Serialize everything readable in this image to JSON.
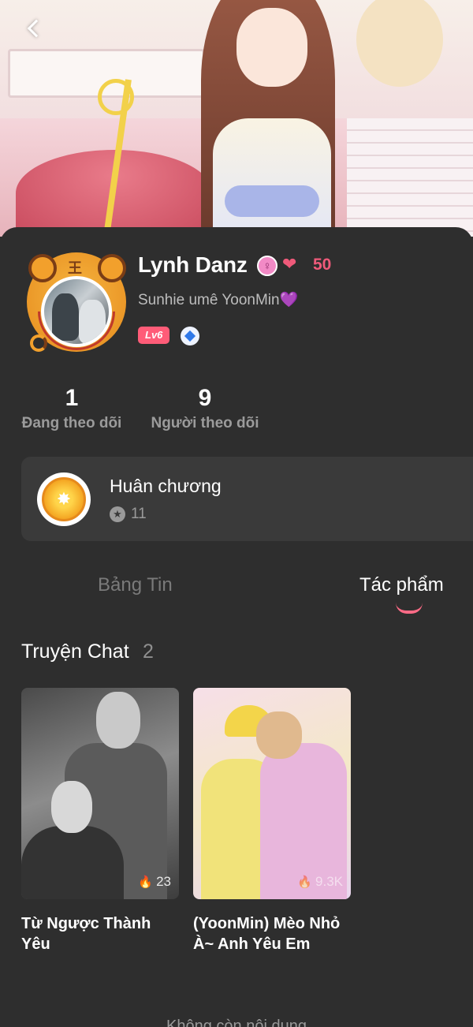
{
  "profile": {
    "name": "Lynh Danz",
    "gender_symbol": "♀",
    "hearts_icon": "❤",
    "hearts": "50",
    "bio": "Sunhie umê YoonMin",
    "bio_emoji": "💜",
    "level": "Lv6",
    "avatar_badge": "王"
  },
  "stats": {
    "following_count": "1",
    "following_label": "Đang theo dõi",
    "followers_count": "9",
    "followers_label": "Người theo dõi"
  },
  "medals": {
    "title": "Huân chương",
    "count": "11",
    "icon": "★"
  },
  "tabs": [
    {
      "label": "Bảng Tin",
      "active": false
    },
    {
      "label": "Tác phẩm",
      "active": true
    }
  ],
  "section": {
    "title": "Truyện Chat",
    "count": "2"
  },
  "stories": [
    {
      "title": "Từ Ngược Thành Yêu",
      "views": "23"
    },
    {
      "title": "(YoonMin) Mèo Nhỏ À~ Anh Yêu Em",
      "views": "9.3K"
    }
  ],
  "footer": {
    "text": "Không còn nội dung"
  },
  "colors": {
    "background": "#2e2e2e",
    "accent_pink": "#ff6b86",
    "heart": "#ef5a7a",
    "level_badge": "#ff5c78"
  },
  "icons": {
    "back": "back-arrow-icon",
    "gender": "female-icon",
    "hearts": "hearts-icon",
    "diamond": "diamond-icon",
    "medal": "medal-icon",
    "views": "flame-icon"
  }
}
